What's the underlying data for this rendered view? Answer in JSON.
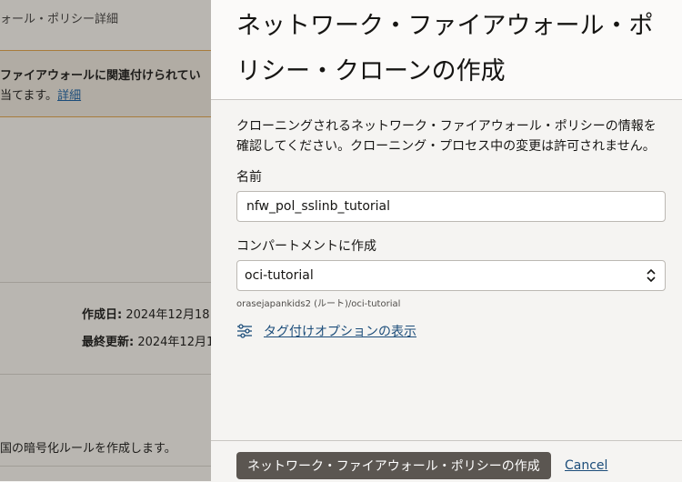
{
  "background": {
    "breadcrumb": "ォール・ポリシー詳細",
    "banner_line1": "ファイアウォールに関連付けられてい",
    "banner_line2": "当てます。",
    "banner_link": "詳細",
    "created_label": "作成日:",
    "created_value": "2024年12月18",
    "updated_label": "最終更新:",
    "updated_value": "2024年12月1",
    "description": "国の暗号化ルールを作成します。"
  },
  "drawer": {
    "title": "ネットワーク・ファイアウォール・ポリシー・クローンの作成",
    "intro": "クローニングされるネットワーク・ファイアウォール・ポリシーの情報を確認してください。クローニング・プロセス中の変更は許可されません。",
    "name_label": "名前",
    "name_value": "nfw_pol_sslinb_tutorial",
    "compartment_label": "コンパートメントに作成",
    "compartment_value": "oci-tutorial",
    "compartment_hint": "orasejapankids2 (ルート)/oci-tutorial",
    "tag_link": "タグ付けオプションの表示",
    "submit_label": "ネットワーク・ファイアウォール・ポリシーの作成",
    "cancel_label": "Cancel"
  },
  "icons": {
    "tag_options": "sliders-icon",
    "select_arrow": "chevron-up-down-icon"
  },
  "colors": {
    "link": "#1c4d7a",
    "primary_button": "#5b5651",
    "overlay": "#b9b6b1"
  }
}
